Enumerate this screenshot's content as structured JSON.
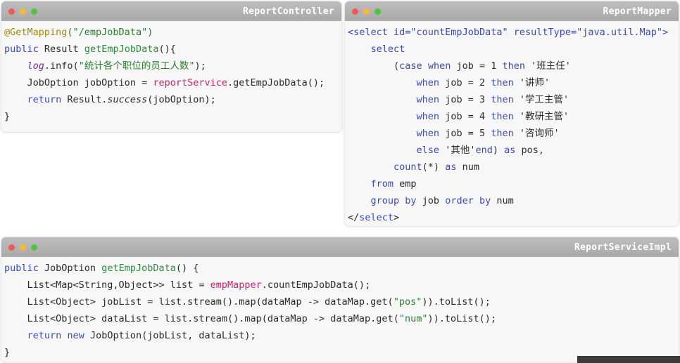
{
  "colors": {
    "titlebar": "#b3b3b3",
    "window_bg": "#f7f7f8",
    "keyword": "#3a4bb5",
    "method": "#2d8a3e",
    "string": "#2a7d2e",
    "annotation": "#a38a00",
    "variable": "#7a2f9a",
    "dot_red": "#ee5b57",
    "dot_yellow": "#f5b93c",
    "dot_green": "#4fc247"
  },
  "controller": {
    "title": "ReportController",
    "annotation": "@GetMapping",
    "mapping_path": "(\"/empJobData\")",
    "kw_public": "public",
    "return_type": " Result ",
    "method_name": "getEmpJobData",
    "method_tail": "(){",
    "log": "log",
    "log_info": ".info(",
    "log_msg": "\"统计各个职位的员工人数\"",
    "log_tail": ");",
    "line4_type": "JobOption jobOption = ",
    "line4_service": "reportService",
    "line4_call": ".getEmpJobData();",
    "kw_return": "return",
    "line5_a": " Result.",
    "line5_success": "success",
    "line5_b": "(jobOption);",
    "close_brace": "}"
  },
  "mapper": {
    "title": "ReportMapper",
    "select_open_a": "<select ",
    "select_open_attr": "id=\"countEmpJobData\" resultType=\"java.util.Map\"",
    "select_open_b": ">",
    "kw_select": "select",
    "paren": "(",
    "kw_case": "case",
    "kw_when": "when",
    "kw_then": "then",
    "kw_else": "else",
    "kw_end": "end",
    "kw_as": "as",
    "job_eq": " job = ",
    "case_rows": [
      {
        "num": "1",
        "label": " '班主任'"
      },
      {
        "num": "2",
        "label": " '讲师'"
      },
      {
        "num": "3",
        "label": " '学工主管'"
      },
      {
        "num": "4",
        "label": " '教研主管'"
      },
      {
        "num": "5",
        "label": " '咨询师'"
      }
    ],
    "else_value": " '其他'",
    "else_tail": ") ",
    "pos_tail": " pos,",
    "count_fn": "count",
    "count_arg": "(*) ",
    "num": " num",
    "kw_from": "from",
    "emp": " emp",
    "kw_group_by": "group by",
    "job": " job ",
    "kw_order_by": "order by",
    "select_close_a": "</",
    "select_close_kw": "select",
    "select_close_b": ">"
  },
  "service": {
    "title": "ReportServiceImpl",
    "kw_public": "public",
    "l1_type": " JobOption ",
    "l1_method": "getEmpJobData",
    "l1_tail": "() {",
    "l2_a": "List<Map<String,Object>> list = ",
    "l2_mapper": "empMapper",
    "l2_b": ".countEmpJobData();",
    "l3_a": "List<Object> jobList = list.stream().map(dataMap -> dataMap.get(",
    "l3_str": "\"pos\"",
    "l3_b": ")).toList();",
    "l4_a": "List<Object> dataList = list.stream().map(dataMap -> dataMap.get(",
    "l4_str": "\"num\"",
    "l4_b": ")).toList();",
    "kw_return": "return",
    "kw_new": "new",
    "l5_tail": " JobOption(jobList, dataList);",
    "close_brace": "}"
  }
}
